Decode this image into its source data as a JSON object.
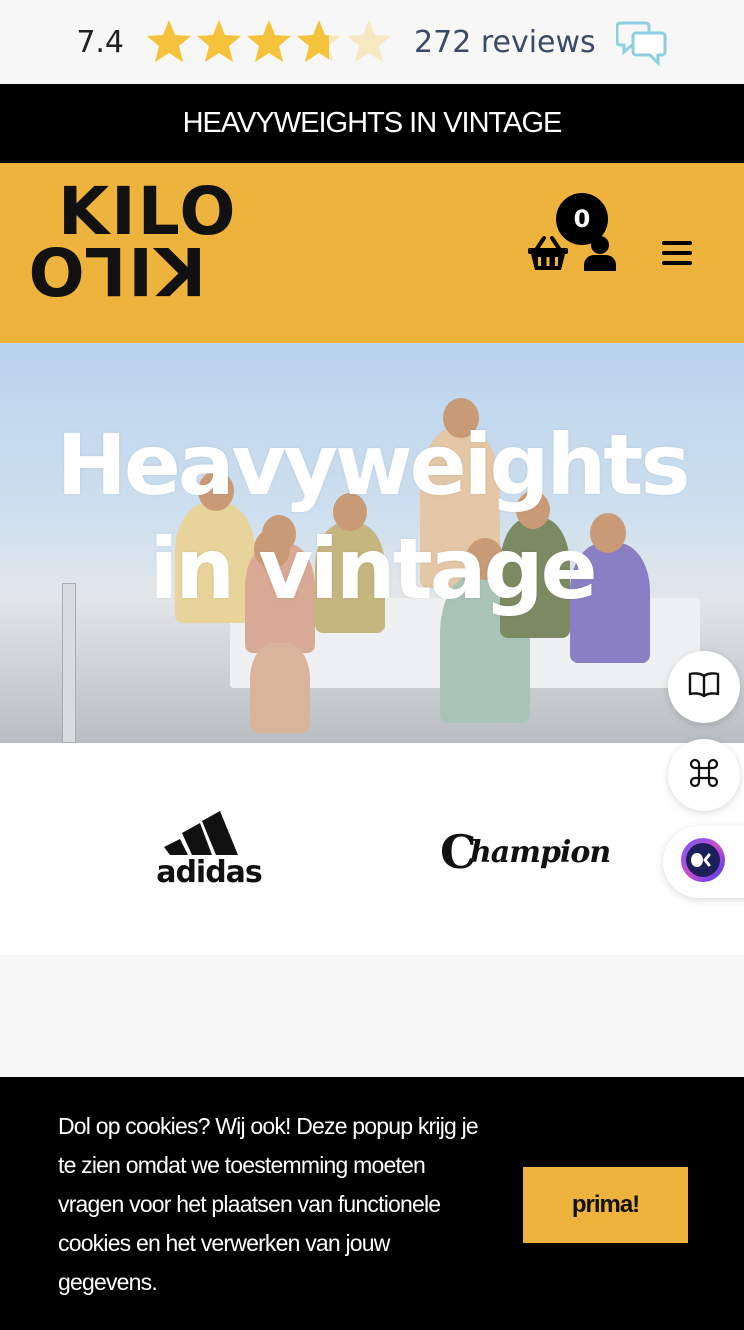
{
  "reviews": {
    "score": "7.4",
    "rating_fraction": 0.74,
    "star_count": 5,
    "count_label": "272 reviews",
    "star_color": "#f5c33b",
    "star_empty_color": "#f7e8c2"
  },
  "announcement": {
    "text": "HEAVYWEIGHTS IN VINTAGE"
  },
  "header": {
    "logo_top": "KILO",
    "logo_bottom": "KILO",
    "cart_count": "0",
    "brand_color": "#edb33c"
  },
  "hero": {
    "title_line1": "Heavyweights",
    "title_line2": "in vintage"
  },
  "brands": {
    "adidas": "adidas",
    "champion_c": "C",
    "champion": "hampion"
  },
  "cookie": {
    "message": "Dol op cookies? Wij ook! Deze popup krijg je te zien omdat we toestemming moeten vragen voor het plaatsen van functionele cookies en het verwerken van jouw gegevens.",
    "accept_label": "prima!"
  }
}
